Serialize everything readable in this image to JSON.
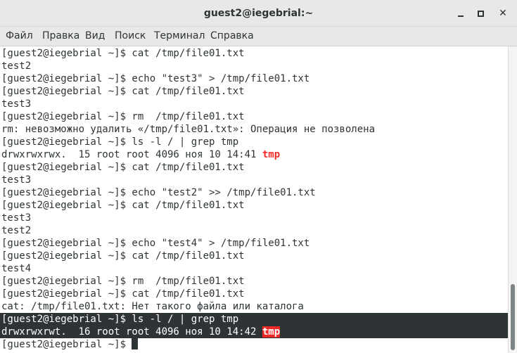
{
  "window": {
    "title": "guest2@iegebrial:~",
    "minimize_glyph": "minimize-icon",
    "maximize_glyph": "maximize-icon",
    "close_glyph": "✕"
  },
  "menu": [
    {
      "label": "Файл"
    },
    {
      "label": "Правка"
    },
    {
      "label": "Вид"
    },
    {
      "label": "Поиск"
    },
    {
      "label": "Терминал"
    },
    {
      "label": "Справка"
    }
  ],
  "terminal": {
    "lines": [
      {
        "text": "[guest2@iegebrial ~]$ cat /tmp/file01.txt"
      },
      {
        "text": "test2"
      },
      {
        "text": "[guest2@iegebrial ~]$ echo \"test3\" > /tmp/file01.txt"
      },
      {
        "text": "[guest2@iegebrial ~]$ cat /tmp/file01.txt"
      },
      {
        "text": "test3"
      },
      {
        "text": "[guest2@iegebrial ~]$ rm  /tmp/file01.txt"
      },
      {
        "text": "rm: невозможно удалить «/tmp/file01.txt»: Операция не позволена"
      },
      {
        "text": "[guest2@iegebrial ~]$ ls -l / | grep tmp"
      },
      {
        "prefix": "drwxrwxrwx.  15 root root 4096 ноя 10 14:41 ",
        "match": "tmp"
      },
      {
        "text": "[guest2@iegebrial ~]$ cat /tmp/file01.txt"
      },
      {
        "text": "test3"
      },
      {
        "text": "[guest2@iegebrial ~]$ echo \"test2\" >> /tmp/file01.txt"
      },
      {
        "text": "[guest2@iegebrial ~]$ cat /tmp/file01.txt"
      },
      {
        "text": "test3"
      },
      {
        "text": "test2"
      },
      {
        "text": "[guest2@iegebrial ~]$ echo \"test4\" > /tmp/file01.txt"
      },
      {
        "text": "[guest2@iegebrial ~]$ cat /tmp/file01.txt"
      },
      {
        "text": "test4"
      },
      {
        "text": "[guest2@iegebrial ~]$ rm  /tmp/file01.txt"
      },
      {
        "text": "[guest2@iegebrial ~]$ cat /tmp/file01.txt"
      },
      {
        "text": "cat: /tmp/file01.txt: Нет такого файла или каталога"
      },
      {
        "text": "[guest2@iegebrial ~]$ ls -l / | grep tmp"
      },
      {
        "prefix": "drwxrwxrwt.  16 root root 4096 ноя 10 14:42 ",
        "match": "tmp"
      },
      {
        "prompt": "[guest2@iegebrial ~]$ "
      }
    ],
    "colors": {
      "text": "#2e3436",
      "background": "#ffffff",
      "grep_match": "#ef2929",
      "selection_band": "#2e3436"
    }
  }
}
